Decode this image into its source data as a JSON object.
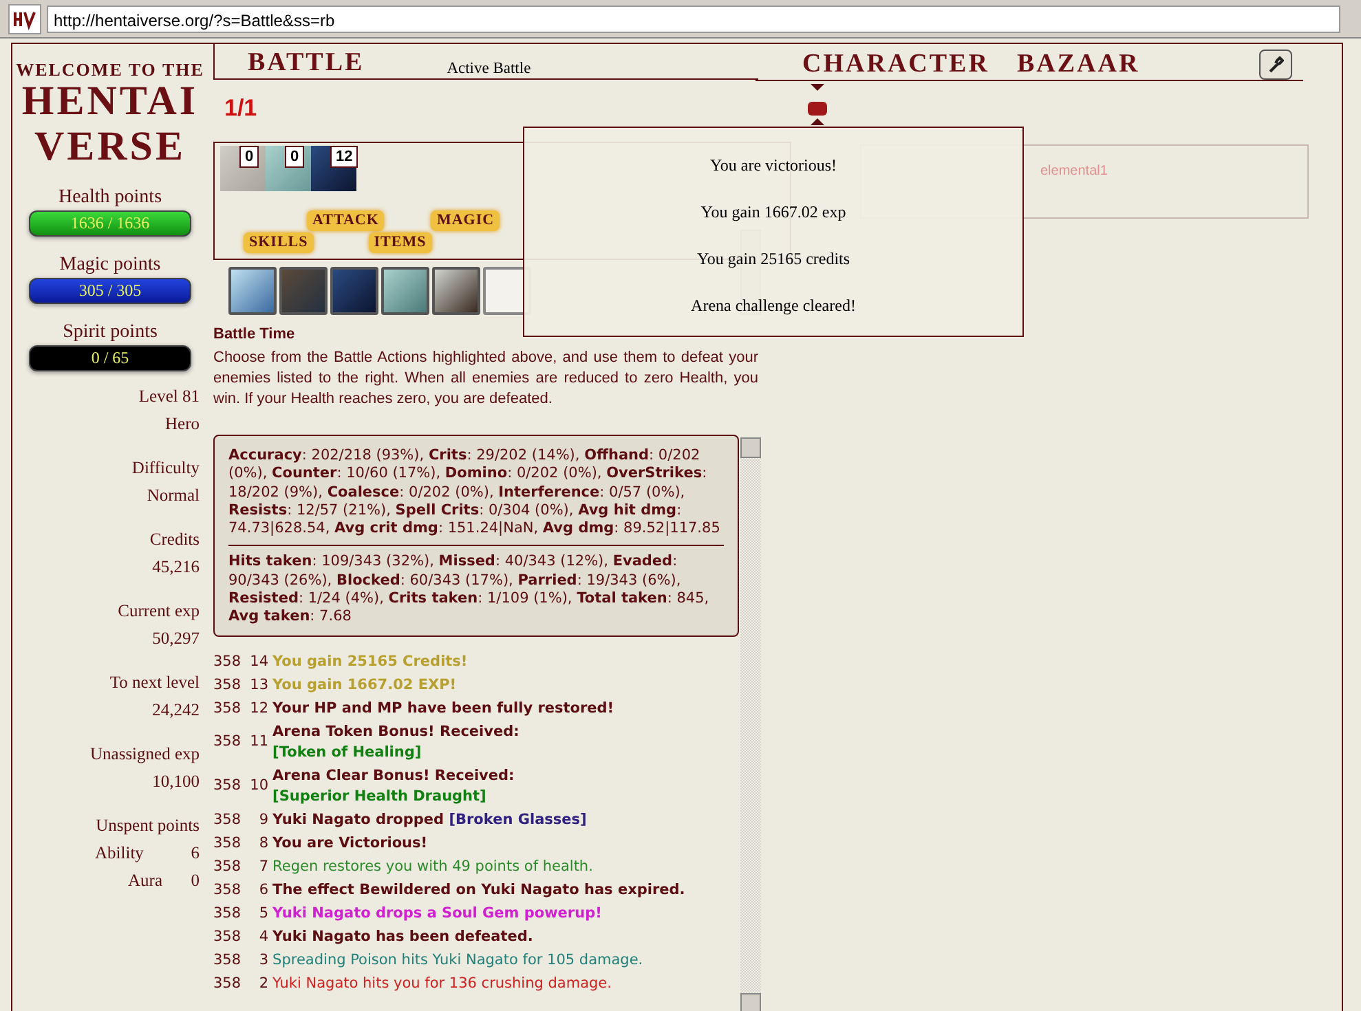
{
  "browser": {
    "url": "http://hentaiverse.org/?s=Battle&ss=rb"
  },
  "logo": {
    "line_1": "WELCOME TO THE",
    "line_2": "HENTAI",
    "line_3": "VERSE"
  },
  "nav": {
    "battle": "BATTLE",
    "subtitle": "Active Battle",
    "character": "CHARACTER",
    "bazaar": "BAZAAR"
  },
  "round": "1/1",
  "vitals": [
    {
      "label": "Health points",
      "reading": "1636 / 1636",
      "level": 1,
      "kind": "health"
    },
    {
      "label": "Magic points",
      "reading": "305 / 305",
      "level": 1,
      "kind": "magic"
    },
    {
      "label": "Spirit points",
      "reading": "0 / 65",
      "level": 0,
      "kind": "spirit"
    }
  ],
  "profile": [
    {
      "label": "Level 81",
      "value": "Hero"
    },
    {
      "label": "Difficulty",
      "value": "Normal"
    },
    {
      "label": "Credits",
      "value": "45,216"
    },
    {
      "label": "Current exp",
      "value": "50,297"
    },
    {
      "label": "To next level",
      "value": "24,242"
    },
    {
      "label": "Unassigned exp",
      "value": "10,100"
    }
  ],
  "unspent": {
    "label": "Unspent points",
    "rows": [
      {
        "label": "Ability",
        "value": "6"
      },
      {
        "label": "Aura",
        "value": "0"
      }
    ]
  },
  "effects": [
    {
      "count": "0"
    },
    {
      "count": "0"
    },
    {
      "count": "12"
    }
  ],
  "actions": [
    [
      "ATTACK",
      "MAGIC"
    ],
    [
      "SKILLS",
      "ITEMS"
    ]
  ],
  "quickbar": [
    {
      "kind": "picture"
    },
    {
      "kind": "picture"
    },
    {
      "kind": "picture"
    },
    {
      "kind": "picture"
    },
    {
      "kind": "picture"
    },
    {
      "kind": "empty"
    }
  ],
  "enemy": {
    "name": "elemental1"
  },
  "popup": {
    "lines": [
      "You are victorious!",
      "You gain 1667.02 exp",
      "You gain 25165 credits",
      "Arena challenge cleared!"
    ]
  },
  "help": {
    "title": "Battle Time",
    "text": "Choose from the Battle Actions highlighted above, and use them to defeat your enemies listed to the right. When all enemies are reduced to zero Health, you win. If your Health reaches zero, you are defeated."
  },
  "stats": [
    "**Accuracy**: 202/218 (93%), **Crits**: 29/202 (14%), **Offhand**: 0/202 (0%), **Counter**: 10/60 (17%), **Domino**: 0/202 (0%), **OverStrikes**: 18/202 (9%), **Coalesce**: 0/202 (0%), **Interference**: 0/57 (0%), **Resists**: 12/57 (21%), **Spell Crits**: 0/304 (0%), **Avg hit dmg**: 74.73|628.54, **Avg crit dmg**: 151.24|NaN, **Avg dmg**: 89.52|117.85",
    "**Hits taken**: 109/343 (32%), **Missed**: 40/343 (12%), **Evaded**: 90/343 (26%), **Blocked**: 60/343 (17%), **Parried**: 19/343 (6%), **Resisted**: 1/24 (4%), **Crits taken**: 1/109 (1%), **Total taken**: 845, **Avg taken**: 7.68"
  ],
  "log": [
    {
      "turn": "358",
      "step": "14",
      "kind": "reward",
      "text": "You gain 25165 Credits!"
    },
    {
      "turn": "358",
      "step": "13",
      "kind": "reward",
      "text": "You gain 1667.02 EXP!"
    },
    {
      "turn": "358",
      "step": "12",
      "kind": "notice",
      "text": "Your HP and MP have been fully restored!"
    },
    {
      "turn": "358",
      "step": "11",
      "kind": "notice",
      "text": "Arena Token Bonus! Received:",
      "item": {
        "text": "[Token of Healing]",
        "kind": "token",
        "new_line": true
      }
    },
    {
      "turn": "358",
      "step": "10",
      "kind": "notice",
      "text": "Arena Clear Bonus! Received:",
      "item": {
        "text": "[Superior Health Draught]",
        "kind": "consumable",
        "new_line": true
      }
    },
    {
      "turn": "358",
      "step": "9",
      "kind": "notice",
      "text": "Yuki Nagato dropped",
      "item": {
        "text": "[Broken Glasses]",
        "kind": "trophy",
        "new_line": false
      }
    },
    {
      "turn": "358",
      "step": "8",
      "kind": "notice",
      "text": "You are Victorious!"
    },
    {
      "turn": "358",
      "step": "7",
      "kind": "heal",
      "text": "Regen restores you with 49 points of health."
    },
    {
      "turn": "358",
      "step": "6",
      "kind": "notice",
      "text": "The effect Bewildered on Yuki Nagato has expired."
    },
    {
      "turn": "358",
      "step": "5",
      "kind": "powerup",
      "text": "Yuki Nagato drops a Soul Gem powerup!"
    },
    {
      "turn": "358",
      "step": "4",
      "kind": "notice",
      "text": "Yuki Nagato has been defeated."
    },
    {
      "turn": "358",
      "step": "3",
      "kind": "dot",
      "text": "Spreading Poison hits Yuki Nagato for 105 damage."
    },
    {
      "turn": "358",
      "step": "2",
      "kind": "damage",
      "text": "Yuki Nagato hits you for 136 crushing damage."
    }
  ]
}
